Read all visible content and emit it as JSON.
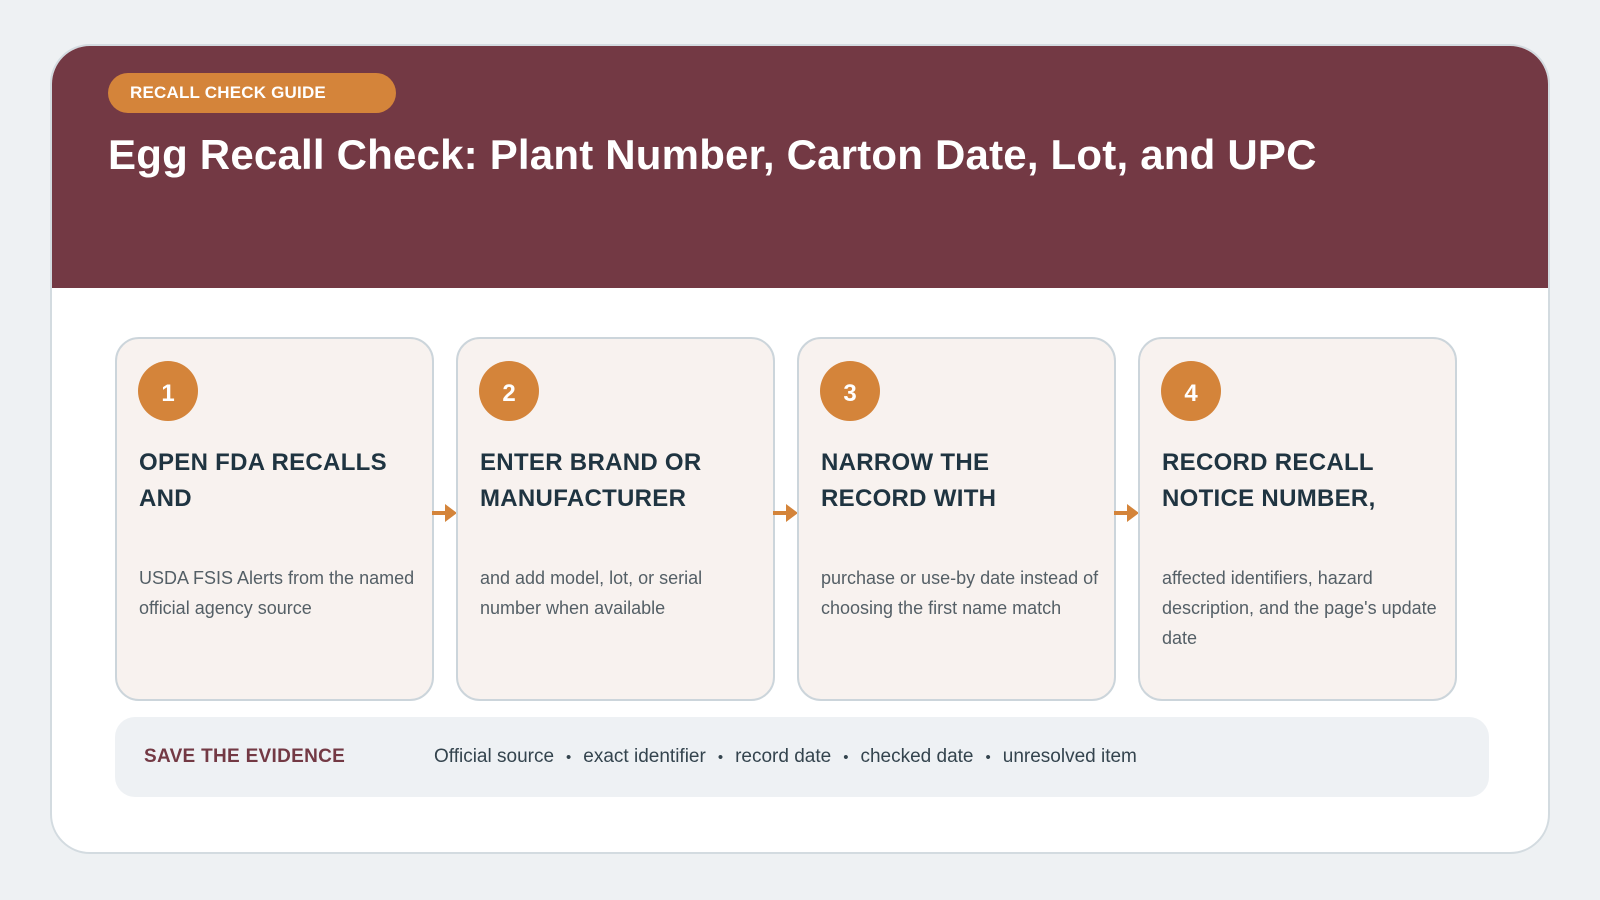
{
  "header": {
    "badge": "RECALL CHECK GUIDE",
    "title": "Egg Recall Check: Plant Number, Carton Date, Lot, and UPC",
    "background": "#733944",
    "accent": "#d4843a"
  },
  "steps": [
    {
      "number": "1",
      "heading": "OPEN FDA RECALLS AND",
      "body": "USDA FSIS Alerts from the named official agency source"
    },
    {
      "number": "2",
      "heading": "ENTER BRAND OR MANUFACTURER",
      "body": "and add model, lot, or serial number when available"
    },
    {
      "number": "3",
      "heading": "NARROW THE RECORD WITH",
      "body": "purchase or use-by date instead of choosing the first name match"
    },
    {
      "number": "4",
      "heading": "RECORD RECALL NOTICE NUMBER,",
      "body": "affected identifiers, hazard description, and the page's update date"
    }
  ],
  "evidence": {
    "label": "SAVE THE EVIDENCE",
    "items": [
      "Official source",
      "exact identifier",
      "record date",
      "checked date",
      "unresolved item"
    ],
    "separator": "•"
  }
}
